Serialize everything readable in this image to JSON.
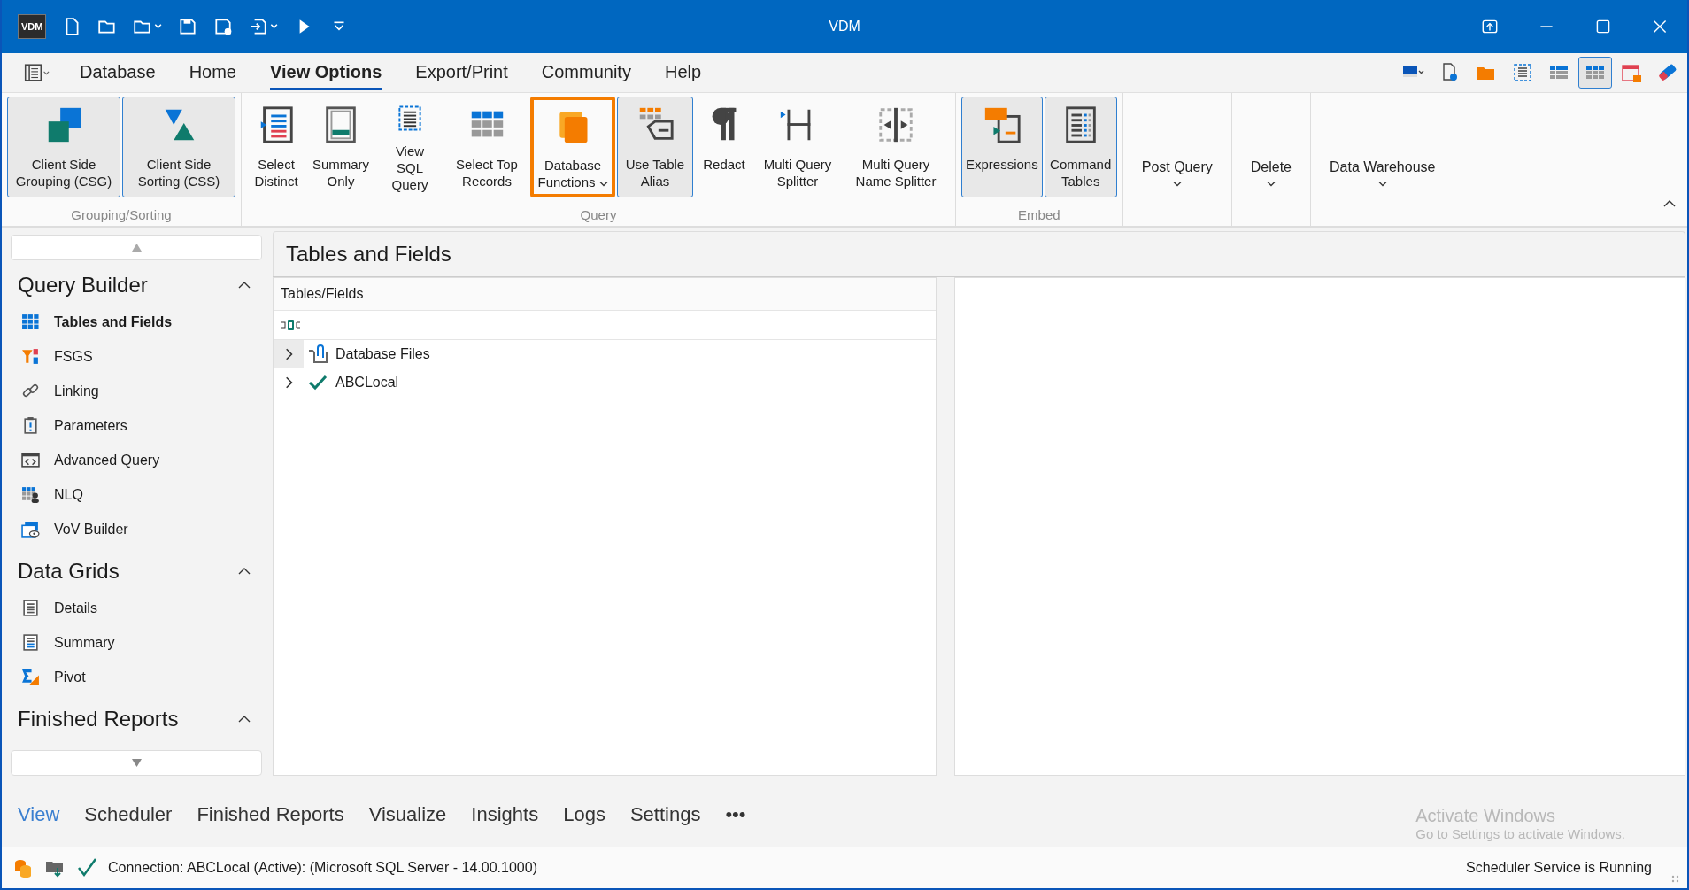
{
  "window": {
    "app_logo": "VDM",
    "title": "VDM"
  },
  "menu_tabs": [
    {
      "label": "Database",
      "selected": false
    },
    {
      "label": "Home",
      "selected": false
    },
    {
      "label": "View Options",
      "selected": true
    },
    {
      "label": "Export/Print",
      "selected": false
    },
    {
      "label": "Community",
      "selected": false
    },
    {
      "label": "Help",
      "selected": false
    }
  ],
  "view_tools": [
    {
      "selected": false
    },
    {
      "selected": false
    },
    {
      "selected": false
    },
    {
      "selected": false
    },
    {
      "selected": false
    },
    {
      "selected": true
    },
    {
      "selected": false
    },
    {
      "selected": false
    }
  ],
  "ribbon_groups": [
    {
      "label": "Grouping/Sorting",
      "buttons": [
        {
          "kind": "large",
          "label": "Client Side Grouping (CSG)",
          "selected": true,
          "highlighted": false,
          "dropdown": false
        },
        {
          "kind": "large",
          "label": "Client Side Sorting (CSS)",
          "selected": true,
          "highlighted": false,
          "dropdown": false
        }
      ]
    },
    {
      "label": "Query",
      "buttons": [
        {
          "kind": "large",
          "label": "Select Distinct",
          "selected": false,
          "highlighted": false,
          "dropdown": false
        },
        {
          "kind": "large",
          "label": "Summary Only",
          "selected": false,
          "highlighted": false,
          "dropdown": false
        },
        {
          "kind": "large",
          "label": "View SQL Query",
          "selected": false,
          "highlighted": false,
          "dropdown": false
        },
        {
          "kind": "large",
          "label": "Select Top Records",
          "selected": false,
          "highlighted": false,
          "dropdown": false
        },
        {
          "kind": "large",
          "label": "Database Functions",
          "selected": false,
          "highlighted": true,
          "dropdown": true
        },
        {
          "kind": "large",
          "label": "Use Table Alias",
          "selected": true,
          "highlighted": false,
          "dropdown": false
        },
        {
          "kind": "large",
          "label": "Redact",
          "selected": false,
          "highlighted": false,
          "dropdown": false
        },
        {
          "kind": "large",
          "label": "Multi Query Splitter",
          "selected": false,
          "highlighted": false,
          "dropdown": false
        },
        {
          "kind": "large",
          "label": "Multi Query Name Splitter",
          "selected": false,
          "highlighted": false,
          "dropdown": false
        }
      ]
    },
    {
      "label": "Embed",
      "buttons": [
        {
          "kind": "large",
          "label": "Expressions",
          "selected": true,
          "highlighted": false,
          "dropdown": false
        },
        {
          "kind": "large",
          "label": "Command Tables",
          "selected": true,
          "highlighted": false,
          "dropdown": false
        }
      ]
    },
    {
      "buttons": [
        {
          "kind": "menu",
          "label": "Post Query",
          "selected": false,
          "highlighted": false,
          "dropdown": true
        }
      ]
    },
    {
      "buttons": [
        {
          "kind": "menu",
          "label": "Delete",
          "selected": false,
          "highlighted": false,
          "dropdown": true
        }
      ]
    },
    {
      "buttons": [
        {
          "kind": "menu",
          "label": "Data Warehouse",
          "selected": false,
          "highlighted": false,
          "dropdown": true
        }
      ]
    }
  ],
  "sidebar": {
    "sections": [
      {
        "title": "Query Builder",
        "expanded": true,
        "items": [
          {
            "label": "Tables and Fields",
            "selected": true
          },
          {
            "label": "FSGS",
            "selected": false
          },
          {
            "label": "Linking",
            "selected": false
          },
          {
            "label": "Parameters",
            "selected": false
          },
          {
            "label": "Advanced Query",
            "selected": false
          },
          {
            "label": "NLQ",
            "selected": false
          },
          {
            "label": "VoV Builder",
            "selected": false
          }
        ]
      },
      {
        "title": "Data Grids",
        "expanded": true,
        "items": [
          {
            "label": "Details",
            "selected": false
          },
          {
            "label": "Summary",
            "selected": false
          },
          {
            "label": "Pivot",
            "selected": false
          }
        ]
      },
      {
        "title": "Finished Reports",
        "expanded": true
      }
    ]
  },
  "content": {
    "title": "Tables and Fields",
    "tree": {
      "column": "Tables/Fields",
      "nodes": [
        {
          "label": "Database Files",
          "expanded": false
        },
        {
          "label": "ABCLocal",
          "expanded": false
        }
      ]
    }
  },
  "bottom_tabs": [
    {
      "label": "View",
      "selected": true
    },
    {
      "label": "Scheduler",
      "selected": false
    },
    {
      "label": "Finished Reports",
      "selected": false
    },
    {
      "label": "Visualize",
      "selected": false
    },
    {
      "label": "Insights",
      "selected": false
    },
    {
      "label": "Logs",
      "selected": false
    },
    {
      "label": "Settings",
      "selected": false
    },
    {
      "label": "•••",
      "selected": false
    }
  ],
  "activation_notice": {
    "title": "Activate Windows",
    "hint": "Go to Settings to activate Windows."
  },
  "status_bar": {
    "connection": "Connection: ABCLocal (Active): (Microsoft SQL Server - 14.00.1000)",
    "scheduler": "Scheduler Service is Running"
  }
}
